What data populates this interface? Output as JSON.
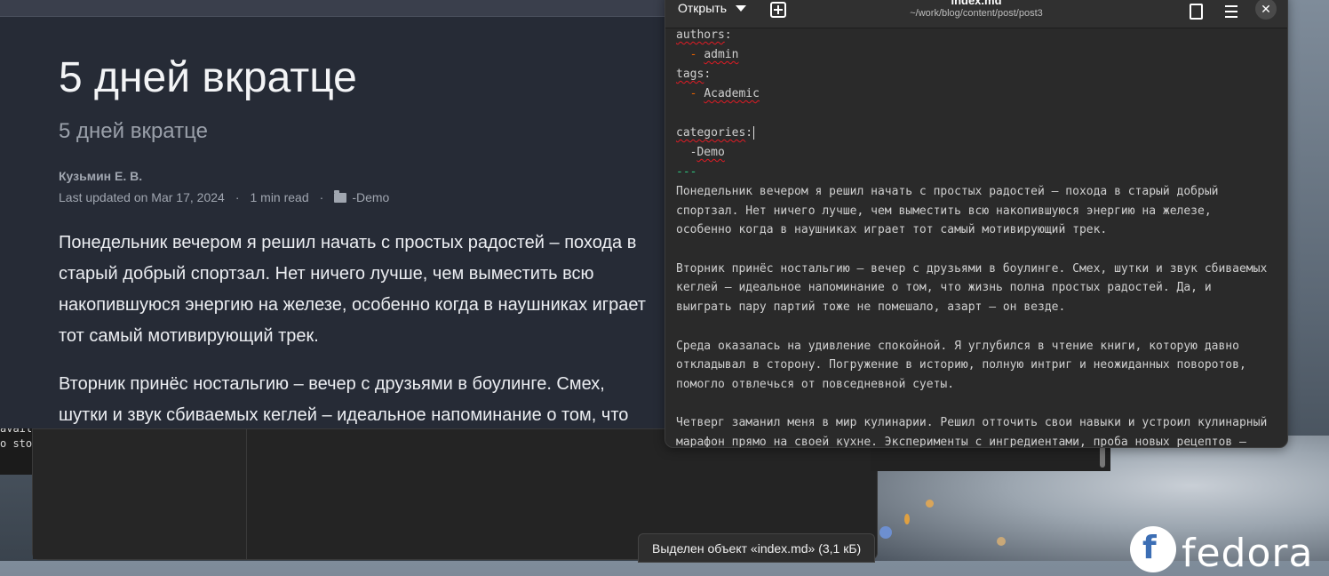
{
  "terminal": {
    "lines": [
      "availa",
      "o sto"
    ]
  },
  "browser": {
    "post_title": "5 дней вкратце",
    "post_subtitle": "5 дней вкратце",
    "author": "Кузьмин Е. В.",
    "last_updated": "Last updated on Mar 17, 2024",
    "read_time": "1 min read",
    "separator": "·",
    "category": "-Demo",
    "paragraph1_lines": [
      "Понедельник вечером я решил начать с простых радостей – похода в",
      "старый добрый спортзал. Нет ничего лучше, чем выместить всю",
      "накопившуюся энергию на железе, особенно когда в наушниках играет",
      "тот самый мотивирующий трек."
    ],
    "paragraph2_lines": [
      "Вторник принёс ностальгию – вечер с друзьями в боулинге. Смех,",
      "шутки и звук сбиваемых кеглей – идеальное напоминание о том, что"
    ]
  },
  "editor": {
    "open_label": "Открыть",
    "title": "index.md",
    "path": "~/work/blog/content/post/post3",
    "close_glyph": "✕",
    "authors_key": "authors",
    "authors_item": "admin",
    "tags_key": "tags",
    "tags_item": "Academic",
    "categories_key": "categories",
    "categories_item": "Demo",
    "yaml_end": "---",
    "para1": [
      "Понедельник вечером я решил начать с простых радостей – похода в старый добрый",
      "спортзал. Нет ничего лучше, чем выместить всю накопившуюся энергию на железе,",
      "особенно когда в наушниках играет тот самый мотивирующий трек."
    ],
    "para2": [
      "Вторник принёс ностальгию – вечер с друзьями в боулинге. Смех, шутки и звук сбиваемых",
      "кеглей – идеальное напоминание о том, что жизнь полна простых радостей. Да, и",
      "выиграть пару партий тоже не помешало, азарт – он везде."
    ],
    "para3": [
      "Среда оказалась на удивление спокойной. Я углубился в чтение книги, которую давно",
      "откладывал в сторону. Погружение в историю, полную интриг и неожиданных поворотов,",
      "помогло отвлечься от повседневной суеты."
    ],
    "para4": [
      "Четверг заманил меня в мир кулинарии. Решил отточить свои навыки и устроил кулинарный",
      "марафон прямо на своей кухне. Эксперименты с ингредиентами, проба новых рецептов –"
    ]
  },
  "status": {
    "selection_text": "Выделен объект «index.md»  (3,1 кБ)"
  },
  "desktop": {
    "logo_text": "fedora"
  }
}
